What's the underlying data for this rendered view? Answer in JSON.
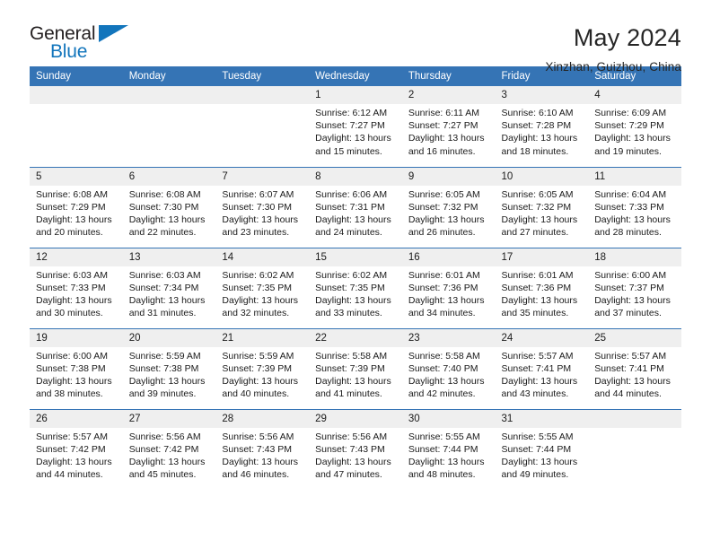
{
  "brand": {
    "name_part1": "General",
    "name_part2": "Blue",
    "flag_icon": "triangle-flag-icon"
  },
  "header": {
    "title": "May 2024",
    "location": "Xinzhan, Guizhou, China"
  },
  "colors": {
    "header_blue": "#3574b5",
    "daynum_band": "#efefef",
    "brand_blue": "#1275bc",
    "text": "#1a1a1a"
  },
  "weekday_headers": [
    "Sunday",
    "Monday",
    "Tuesday",
    "Wednesday",
    "Thursday",
    "Friday",
    "Saturday"
  ],
  "labels": {
    "sunrise": "Sunrise:",
    "sunset": "Sunset:",
    "daylight": "Daylight:"
  },
  "weeks": [
    [
      {
        "day": "",
        "empty": true
      },
      {
        "day": "",
        "empty": true
      },
      {
        "day": "",
        "empty": true
      },
      {
        "day": "1",
        "sunrise": "Sunrise: 6:12 AM",
        "sunset": "Sunset: 7:27 PM",
        "daylight": "Daylight: 13 hours and 15 minutes."
      },
      {
        "day": "2",
        "sunrise": "Sunrise: 6:11 AM",
        "sunset": "Sunset: 7:27 PM",
        "daylight": "Daylight: 13 hours and 16 minutes."
      },
      {
        "day": "3",
        "sunrise": "Sunrise: 6:10 AM",
        "sunset": "Sunset: 7:28 PM",
        "daylight": "Daylight: 13 hours and 18 minutes."
      },
      {
        "day": "4",
        "sunrise": "Sunrise: 6:09 AM",
        "sunset": "Sunset: 7:29 PM",
        "daylight": "Daylight: 13 hours and 19 minutes."
      }
    ],
    [
      {
        "day": "5",
        "sunrise": "Sunrise: 6:08 AM",
        "sunset": "Sunset: 7:29 PM",
        "daylight": "Daylight: 13 hours and 20 minutes."
      },
      {
        "day": "6",
        "sunrise": "Sunrise: 6:08 AM",
        "sunset": "Sunset: 7:30 PM",
        "daylight": "Daylight: 13 hours and 22 minutes."
      },
      {
        "day": "7",
        "sunrise": "Sunrise: 6:07 AM",
        "sunset": "Sunset: 7:30 PM",
        "daylight": "Daylight: 13 hours and 23 minutes."
      },
      {
        "day": "8",
        "sunrise": "Sunrise: 6:06 AM",
        "sunset": "Sunset: 7:31 PM",
        "daylight": "Daylight: 13 hours and 24 minutes."
      },
      {
        "day": "9",
        "sunrise": "Sunrise: 6:05 AM",
        "sunset": "Sunset: 7:32 PM",
        "daylight": "Daylight: 13 hours and 26 minutes."
      },
      {
        "day": "10",
        "sunrise": "Sunrise: 6:05 AM",
        "sunset": "Sunset: 7:32 PM",
        "daylight": "Daylight: 13 hours and 27 minutes."
      },
      {
        "day": "11",
        "sunrise": "Sunrise: 6:04 AM",
        "sunset": "Sunset: 7:33 PM",
        "daylight": "Daylight: 13 hours and 28 minutes."
      }
    ],
    [
      {
        "day": "12",
        "sunrise": "Sunrise: 6:03 AM",
        "sunset": "Sunset: 7:33 PM",
        "daylight": "Daylight: 13 hours and 30 minutes."
      },
      {
        "day": "13",
        "sunrise": "Sunrise: 6:03 AM",
        "sunset": "Sunset: 7:34 PM",
        "daylight": "Daylight: 13 hours and 31 minutes."
      },
      {
        "day": "14",
        "sunrise": "Sunrise: 6:02 AM",
        "sunset": "Sunset: 7:35 PM",
        "daylight": "Daylight: 13 hours and 32 minutes."
      },
      {
        "day": "15",
        "sunrise": "Sunrise: 6:02 AM",
        "sunset": "Sunset: 7:35 PM",
        "daylight": "Daylight: 13 hours and 33 minutes."
      },
      {
        "day": "16",
        "sunrise": "Sunrise: 6:01 AM",
        "sunset": "Sunset: 7:36 PM",
        "daylight": "Daylight: 13 hours and 34 minutes."
      },
      {
        "day": "17",
        "sunrise": "Sunrise: 6:01 AM",
        "sunset": "Sunset: 7:36 PM",
        "daylight": "Daylight: 13 hours and 35 minutes."
      },
      {
        "day": "18",
        "sunrise": "Sunrise: 6:00 AM",
        "sunset": "Sunset: 7:37 PM",
        "daylight": "Daylight: 13 hours and 37 minutes."
      }
    ],
    [
      {
        "day": "19",
        "sunrise": "Sunrise: 6:00 AM",
        "sunset": "Sunset: 7:38 PM",
        "daylight": "Daylight: 13 hours and 38 minutes."
      },
      {
        "day": "20",
        "sunrise": "Sunrise: 5:59 AM",
        "sunset": "Sunset: 7:38 PM",
        "daylight": "Daylight: 13 hours and 39 minutes."
      },
      {
        "day": "21",
        "sunrise": "Sunrise: 5:59 AM",
        "sunset": "Sunset: 7:39 PM",
        "daylight": "Daylight: 13 hours and 40 minutes."
      },
      {
        "day": "22",
        "sunrise": "Sunrise: 5:58 AM",
        "sunset": "Sunset: 7:39 PM",
        "daylight": "Daylight: 13 hours and 41 minutes."
      },
      {
        "day": "23",
        "sunrise": "Sunrise: 5:58 AM",
        "sunset": "Sunset: 7:40 PM",
        "daylight": "Daylight: 13 hours and 42 minutes."
      },
      {
        "day": "24",
        "sunrise": "Sunrise: 5:57 AM",
        "sunset": "Sunset: 7:41 PM",
        "daylight": "Daylight: 13 hours and 43 minutes."
      },
      {
        "day": "25",
        "sunrise": "Sunrise: 5:57 AM",
        "sunset": "Sunset: 7:41 PM",
        "daylight": "Daylight: 13 hours and 44 minutes."
      }
    ],
    [
      {
        "day": "26",
        "sunrise": "Sunrise: 5:57 AM",
        "sunset": "Sunset: 7:42 PM",
        "daylight": "Daylight: 13 hours and 44 minutes."
      },
      {
        "day": "27",
        "sunrise": "Sunrise: 5:56 AM",
        "sunset": "Sunset: 7:42 PM",
        "daylight": "Daylight: 13 hours and 45 minutes."
      },
      {
        "day": "28",
        "sunrise": "Sunrise: 5:56 AM",
        "sunset": "Sunset: 7:43 PM",
        "daylight": "Daylight: 13 hours and 46 minutes."
      },
      {
        "day": "29",
        "sunrise": "Sunrise: 5:56 AM",
        "sunset": "Sunset: 7:43 PM",
        "daylight": "Daylight: 13 hours and 47 minutes."
      },
      {
        "day": "30",
        "sunrise": "Sunrise: 5:55 AM",
        "sunset": "Sunset: 7:44 PM",
        "daylight": "Daylight: 13 hours and 48 minutes."
      },
      {
        "day": "31",
        "sunrise": "Sunrise: 5:55 AM",
        "sunset": "Sunset: 7:44 PM",
        "daylight": "Daylight: 13 hours and 49 minutes."
      },
      {
        "day": "",
        "empty": true
      }
    ]
  ]
}
